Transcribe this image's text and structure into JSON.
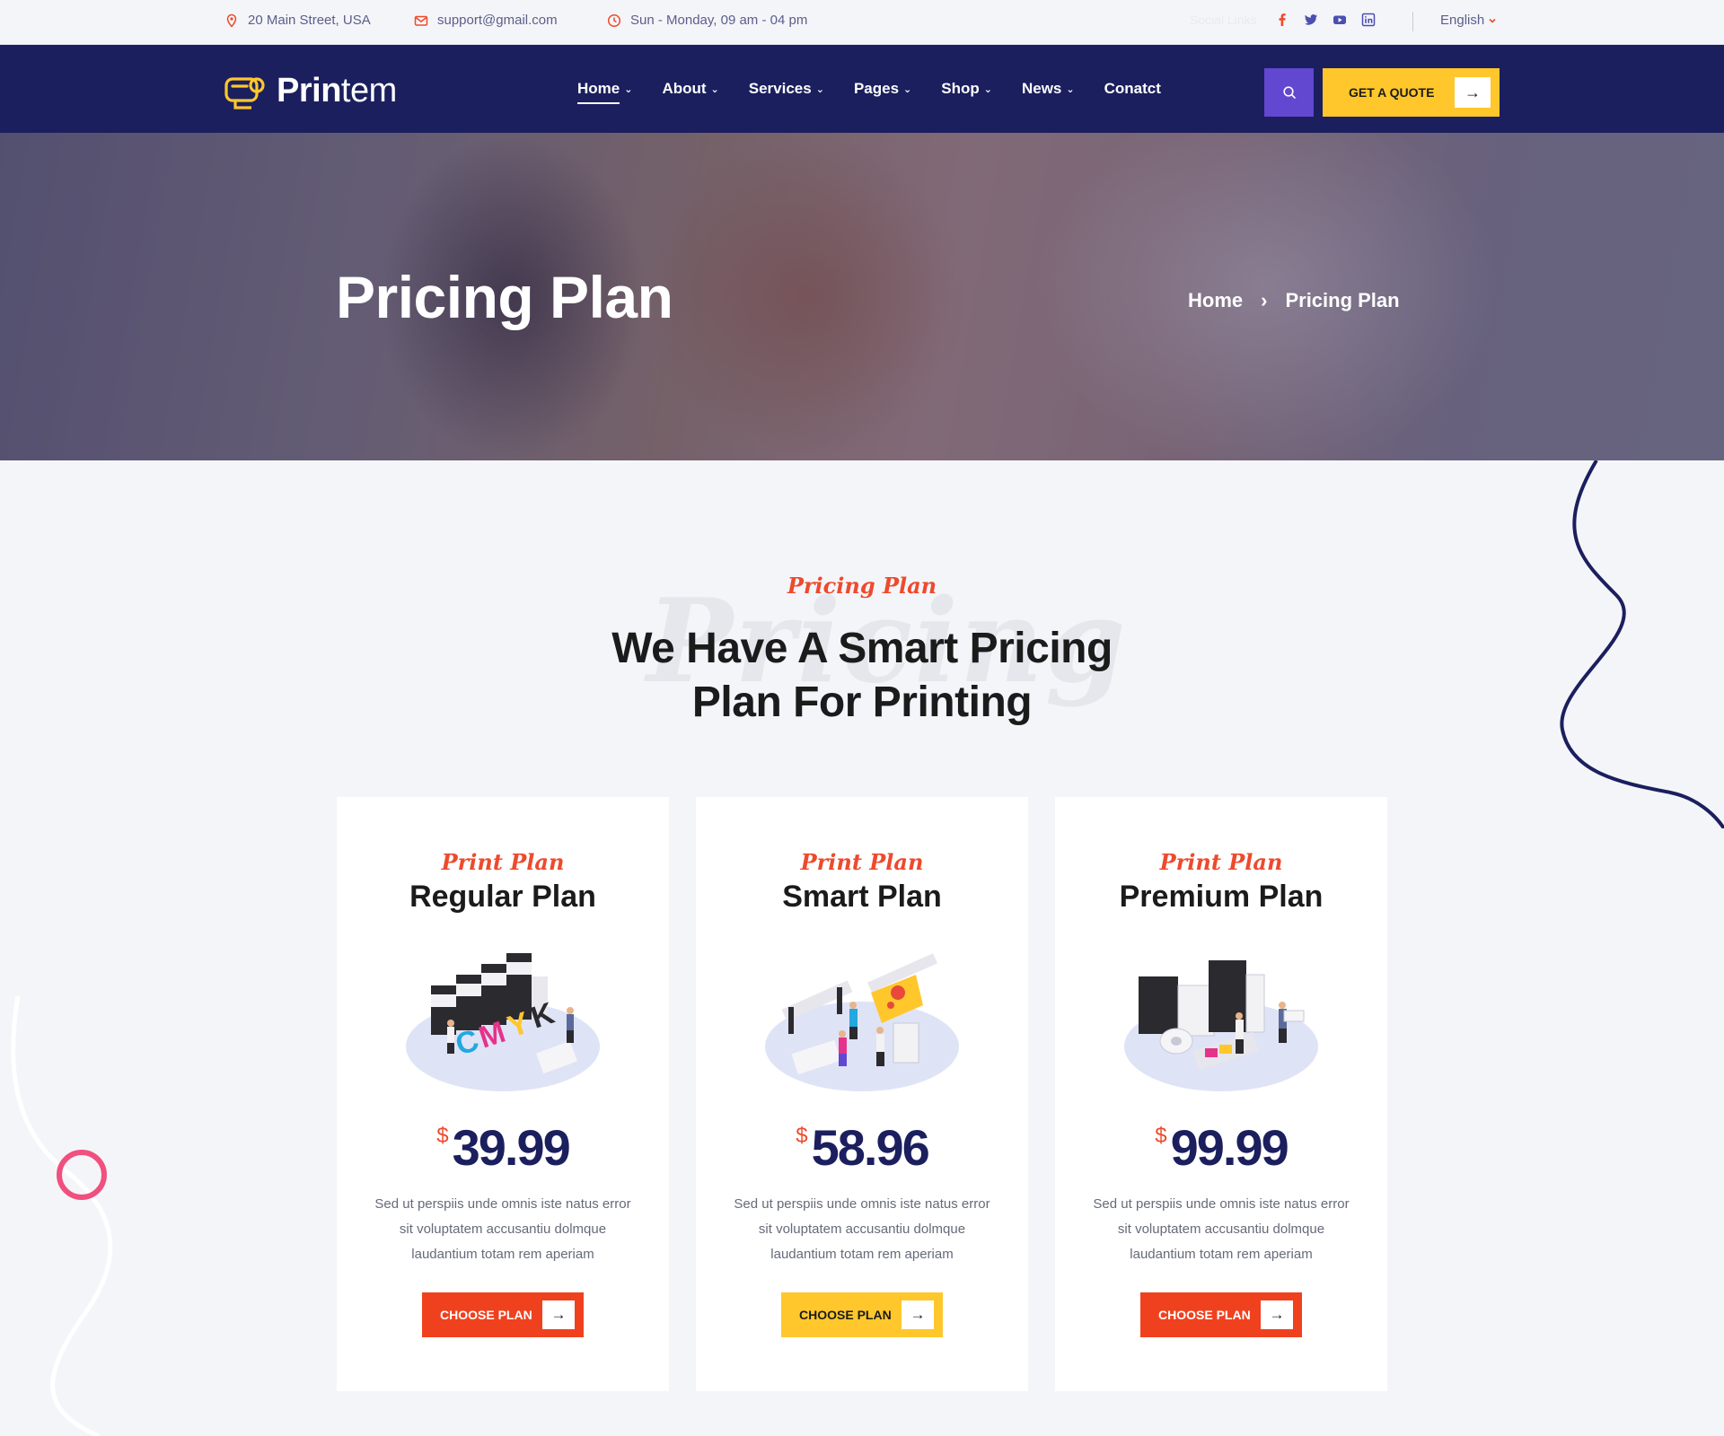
{
  "topbar": {
    "address": "20 Main Street, USA",
    "email": "support@gmail.com",
    "hours": "Sun - Monday, 09 am - 04 pm",
    "social_label": "Social Links",
    "language": "English"
  },
  "nav": {
    "logo_bold": "Prin",
    "logo_light": "tem",
    "menu": [
      {
        "label": "Home"
      },
      {
        "label": "About"
      },
      {
        "label": "Services"
      },
      {
        "label": "Pages"
      },
      {
        "label": "Shop"
      },
      {
        "label": "News"
      },
      {
        "label": "Conatct"
      }
    ],
    "quote_label": "GET A QUOTE"
  },
  "hero": {
    "title": "Pricing Plan",
    "breadcrumb_home": "Home",
    "breadcrumb_current": "Pricing Plan"
  },
  "section": {
    "subtitle": "Pricing Plan",
    "ghost": "Pricing",
    "title_line1": "We Have A Smart Pricing",
    "title_line2": "Plan For Printing"
  },
  "plans": [
    {
      "tag": "Print Plan",
      "name": "Regular Plan",
      "currency": "$",
      "price": "39.99",
      "desc": "Sed ut perspiis unde omnis iste natus error sit voluptatem accusantiu dolmque laudantium totam rem aperiam",
      "button": "CHOOSE PLAN"
    },
    {
      "tag": "Print Plan",
      "name": "Smart Plan",
      "currency": "$",
      "price": "58.96",
      "desc": "Sed ut perspiis unde omnis iste natus error sit voluptatem accusantiu dolmque laudantium totam rem aperiam",
      "button": "CHOOSE PLAN"
    },
    {
      "tag": "Print Plan",
      "name": "Premium Plan",
      "currency": "$",
      "price": "99.99",
      "desc": "Sed ut perspiis unde omnis iste natus error sit voluptatem accusantiu dolmque laudantium totam rem aperiam",
      "button": "CHOOSE PLAN"
    }
  ],
  "colors": {
    "navy": "#1b1f5e",
    "accent_red": "#f0411f",
    "accent_yellow": "#ffc72c",
    "accent_purple": "#6247d0",
    "background": "#f4f5f9"
  },
  "icons": [
    "map-pin-icon",
    "envelope-icon",
    "clock-icon",
    "facebook-icon",
    "twitter-icon",
    "youtube-icon",
    "linkedin-icon",
    "chevron-down-icon",
    "search-icon",
    "arrow-right-icon",
    "chevron-right-icon",
    "printer-roll-logo-icon"
  ]
}
